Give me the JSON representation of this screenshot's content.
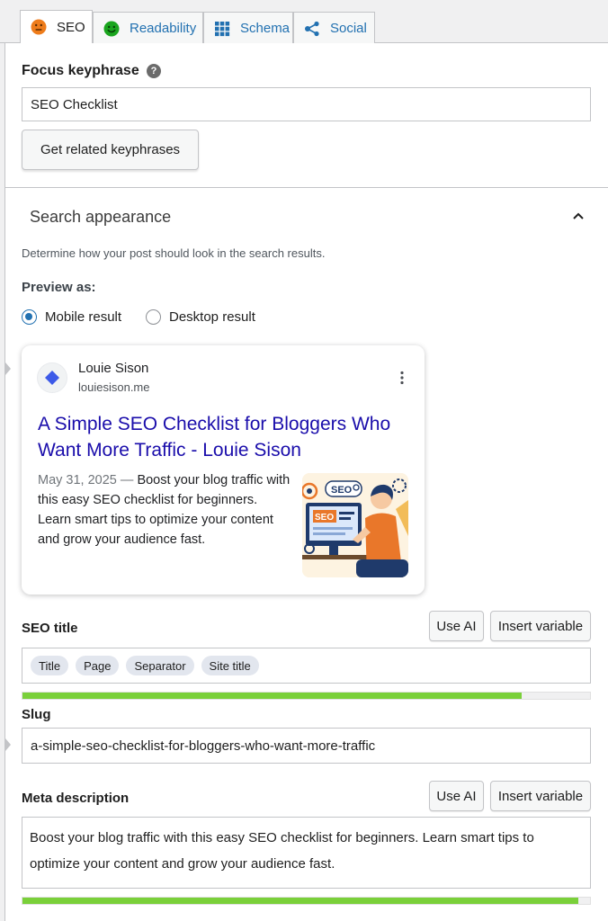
{
  "tabs": [
    {
      "label": "SEO",
      "icon": "orange-face-icon"
    },
    {
      "label": "Readability",
      "icon": "green-smiley-icon"
    },
    {
      "label": "Schema",
      "icon": "grid-icon"
    },
    {
      "label": "Social",
      "icon": "share-icon"
    }
  ],
  "colors": {
    "accent": "#2271b1",
    "link_title": "#1a0dab",
    "seo_face": "#ee7c1b",
    "readability_face": "#1aa51e",
    "progress_good": "#7ad03a"
  },
  "focus_keyphrase": {
    "label": "Focus keyphrase",
    "help": "?",
    "value": "SEO Checklist",
    "related_button": "Get related keyphrases"
  },
  "search_appearance": {
    "title": "Search appearance",
    "description": "Determine how your post should look in the search results.",
    "preview_as_label": "Preview as:",
    "options": [
      {
        "label": "Mobile result",
        "selected": true
      },
      {
        "label": "Desktop result",
        "selected": false
      }
    ]
  },
  "preview": {
    "site_name": "Louie Sison",
    "site_url": "louiesison.me",
    "title": "A Simple SEO Checklist for Bloggers Who Want More Traffic - Louie Sison",
    "date": "May 31, 2025",
    "date_separator": "—",
    "snippet": "Boost your blog traffic with this easy SEO checklist for beginners. Learn smart tips to optimize your content and grow your audience fast.",
    "thumbnail_labels": [
      "SEO",
      "SEO"
    ]
  },
  "seo_title": {
    "label": "SEO title",
    "use_ai": "Use AI",
    "insert_variable": "Insert variable",
    "chips": [
      "Title",
      "Page",
      "Separator",
      "Site title"
    ],
    "progress": 0.88
  },
  "slug": {
    "label": "Slug",
    "value": "a-simple-seo-checklist-for-bloggers-who-want-more-traffic"
  },
  "meta_description": {
    "label": "Meta description",
    "use_ai": "Use AI",
    "insert_variable": "Insert variable",
    "value": "Boost your blog traffic with this easy SEO checklist for beginners. Learn smart tips to optimize your content and grow your audience fast.",
    "progress": 0.98
  }
}
